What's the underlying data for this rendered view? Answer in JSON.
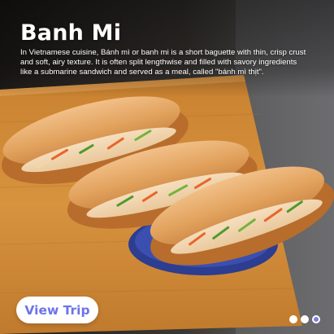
{
  "card": {
    "title": "Banh Mi",
    "description": "In Vietnamese cuisine, Bánh mì or banh mi is a short baguette with thin, crisp crust and soft, airy texture. It is often split lengthwise and filled with savory ingredients like a submarine sandwich and served as a meal, called \"bánh mì thịt\".",
    "cta_label": "View Trip"
  },
  "pagination": {
    "total": 3,
    "active_index": 2
  },
  "colors": {
    "accent": "#6d73e8",
    "dot_active": "#7b7fe0",
    "dot_inactive": "#ffffff"
  }
}
